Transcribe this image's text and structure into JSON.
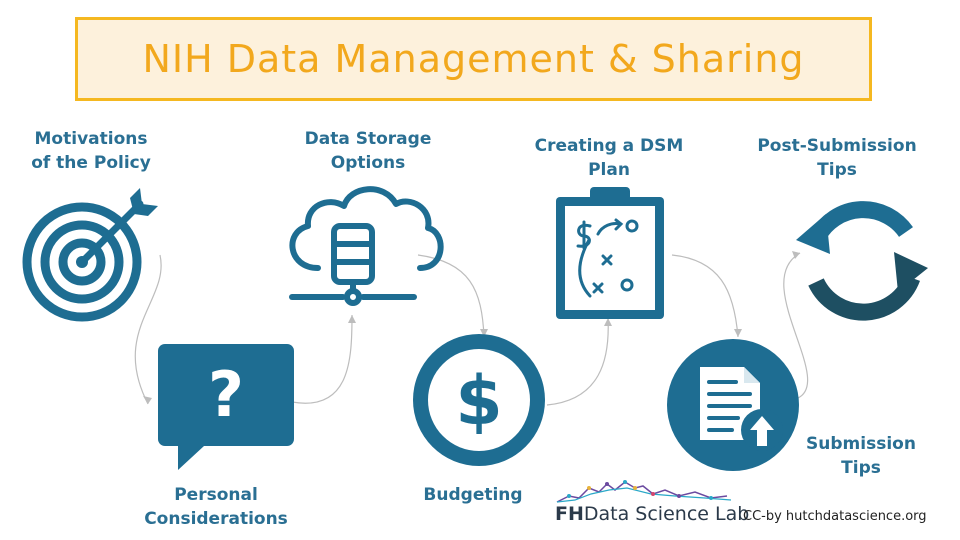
{
  "title": "NIH Data Management & Sharing",
  "steps": {
    "motivations": {
      "line1": "Motivations",
      "line2": "of the Policy"
    },
    "personal": {
      "line1": "Personal",
      "line2": "Considerations"
    },
    "storage": {
      "line1": "Data Storage",
      "line2": "Options"
    },
    "budgeting": {
      "line1": "Budgeting"
    },
    "dsm_plan": {
      "line1": "Creating a DSM",
      "line2": "Plan"
    },
    "submission": {
      "line1": "Submission",
      "line2": "Tips"
    },
    "post_submission": {
      "line1": "Post-Submission",
      "line2": "Tips"
    }
  },
  "icons": [
    "target-icon",
    "question-bubble-icon",
    "cloud-database-icon",
    "dollar-icon",
    "clipboard-plan-icon",
    "document-upload-icon",
    "refresh-cycle-icon"
  ],
  "logo": {
    "bold": "FH",
    "rest": "Data Science Lab"
  },
  "credit": "CC-by hutchdatascience.org",
  "colors": {
    "accent": "#1e6d92",
    "title": "#f2a81d",
    "title_bg": "#fdf1dc",
    "label": "#2a6f93"
  }
}
